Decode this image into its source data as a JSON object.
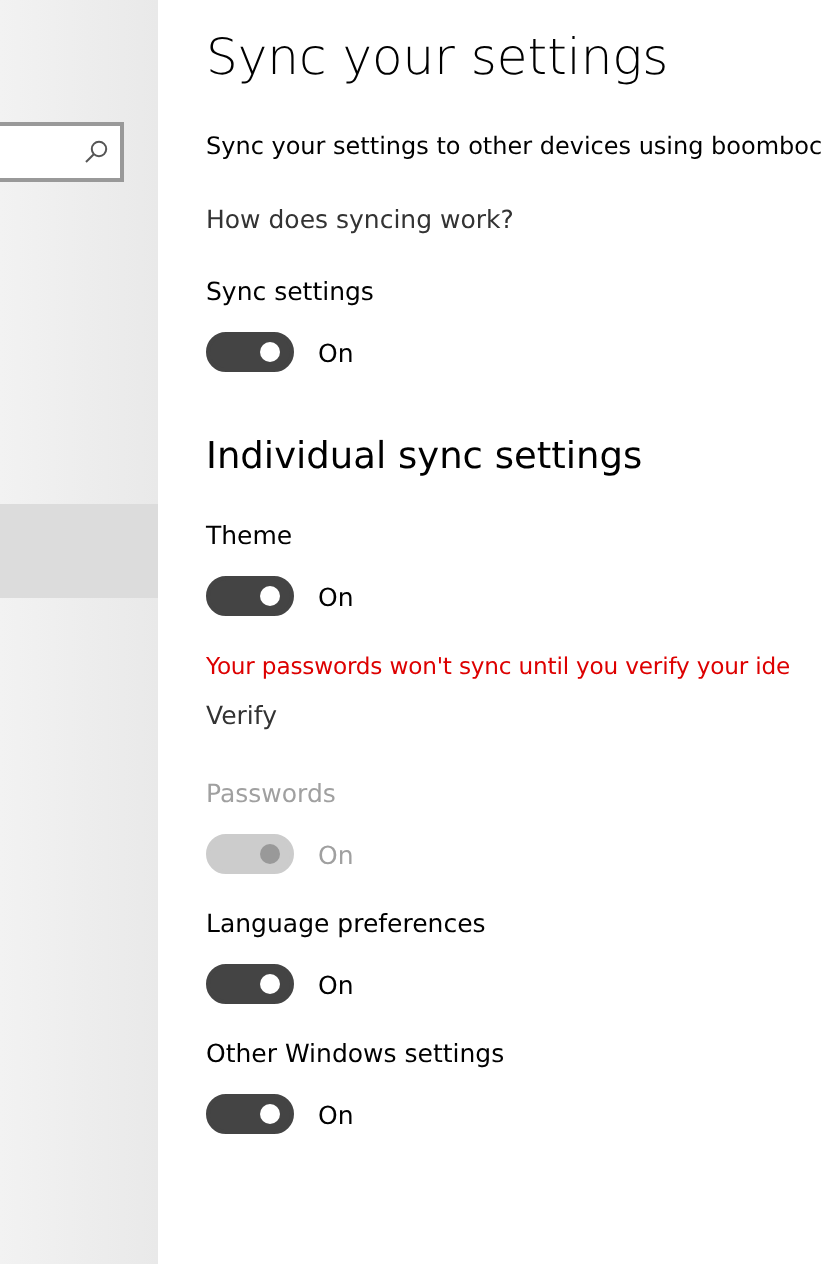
{
  "page": {
    "title": "Sync your settings",
    "description": "Sync your settings to other devices using boomboc",
    "help_link": "How does syncing work?"
  },
  "master": {
    "label": "Sync settings",
    "on": true,
    "disabled": false,
    "state_text": "On"
  },
  "section": {
    "heading": "Individual sync settings",
    "items": [
      {
        "kind": "toggle",
        "label": "Theme",
        "on": true,
        "disabled": false,
        "state_text": "On"
      },
      {
        "kind": "warning",
        "text": "Your passwords won't sync until you verify your ide",
        "action": "Verify"
      },
      {
        "kind": "toggle",
        "label": "Passwords",
        "on": true,
        "disabled": true,
        "state_text": "On"
      },
      {
        "kind": "toggle",
        "label": "Language preferences",
        "on": true,
        "disabled": false,
        "state_text": "On"
      },
      {
        "kind": "toggle",
        "label": "Other Windows settings",
        "on": true,
        "disabled": false,
        "state_text": "On"
      }
    ]
  }
}
